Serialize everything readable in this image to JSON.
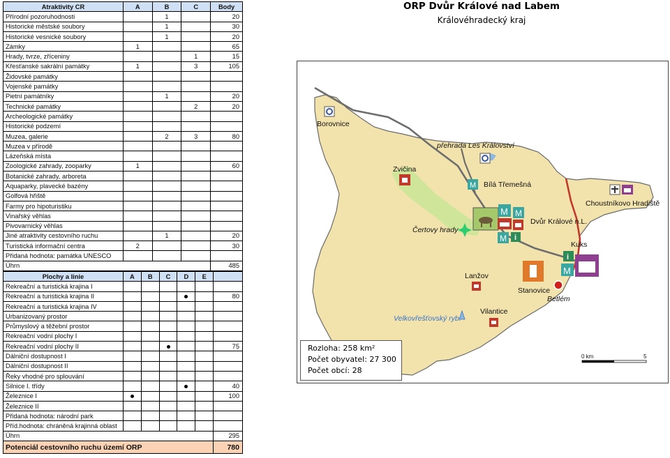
{
  "table_attractions": {
    "headers": [
      "Atraktivity CR",
      "A",
      "B",
      "C",
      "Body"
    ],
    "rows": [
      [
        "Přírodní pozoruhodnosti",
        "",
        "1",
        "",
        "20"
      ],
      [
        "Historické městské soubory",
        "",
        "1",
        "",
        "30"
      ],
      [
        "Historické vesnické soubory",
        "",
        "1",
        "",
        "20"
      ],
      [
        "Zámky",
        "1",
        "",
        "",
        "65"
      ],
      [
        "Hrady, tvrze, zříceniny",
        "",
        "",
        "1",
        "15"
      ],
      [
        "Křesťanské sakrální památky",
        "1",
        "",
        "3",
        "105"
      ],
      [
        "Židovské památky",
        "",
        "",
        "",
        ""
      ],
      [
        "Vojenské památky",
        "",
        "",
        "",
        ""
      ],
      [
        "Pietní památníky",
        "",
        "1",
        "",
        "20"
      ],
      [
        "Technické památky",
        "",
        "",
        "2",
        "20"
      ],
      [
        "Archeologické památky",
        "",
        "",
        "",
        ""
      ],
      [
        "Historické podzemí",
        "",
        "",
        "",
        ""
      ],
      [
        "Muzea, galerie",
        "",
        "2",
        "3",
        "80"
      ],
      [
        "Muzea v přírodě",
        "",
        "",
        "",
        ""
      ],
      [
        "Lázeňská místa",
        "",
        "",
        "",
        ""
      ],
      [
        "Zoologické zahrady, zooparky",
        "1",
        "",
        "",
        "60"
      ],
      [
        "Botanické zahrady, arboreta",
        "",
        "",
        "",
        ""
      ],
      [
        "Aquaparky, plavecké bazény",
        "",
        "",
        "",
        ""
      ],
      [
        "Golfová hřiště",
        "",
        "",
        "",
        ""
      ],
      [
        "Farmy pro hipoturistiku",
        "",
        "",
        "",
        ""
      ],
      [
        "Vinařský věhlas",
        "",
        "",
        "",
        ""
      ],
      [
        "Pivovarnický věhlas",
        "",
        "",
        "",
        ""
      ],
      [
        "Jiné atraktivity cestovního ruchu",
        "",
        "1",
        "",
        "20"
      ],
      [
        "Turistická informační centra",
        "2",
        "",
        "",
        "30"
      ],
      [
        "Přidaná hodnota: památka UNESCO",
        "",
        "",
        "",
        ""
      ]
    ],
    "sum_label": "Úhrn",
    "sum_value": "485"
  },
  "table_areas": {
    "headers": [
      "Plochy a linie",
      "A",
      "B",
      "C",
      "D",
      "E",
      ""
    ],
    "rows": [
      {
        "label": "Rekreační a turistická krajina I",
        "dot": -1,
        "value": ""
      },
      {
        "label": "Rekreační a turistická krajina II",
        "dot": 3,
        "value": "80"
      },
      {
        "label": "Rekreační a turistická krajina IV",
        "dot": -1,
        "value": ""
      },
      {
        "label": "Urbanizovaný prostor",
        "dot": -1,
        "value": ""
      },
      {
        "label": "Průmyslový a těžební prostor",
        "dot": -1,
        "value": ""
      },
      {
        "label": "Rekreační vodní plochy I",
        "dot": -1,
        "value": ""
      },
      {
        "label": "Rekreační vodní plochy II",
        "dot": 2,
        "value": "75"
      },
      {
        "label": "Dálniční dostupnost I",
        "dot": -1,
        "value": ""
      },
      {
        "label": "Dálniční dostupnost II",
        "dot": -1,
        "value": ""
      },
      {
        "label": "Řeky vhodné pro splouvání",
        "dot": -1,
        "value": ""
      },
      {
        "label": "Silnice I. třídy",
        "dot": 3,
        "value": "40"
      },
      {
        "label": "Železnice I",
        "dot": 0,
        "value": "100"
      },
      {
        "label": "Železnice II",
        "dot": -1,
        "value": ""
      },
      {
        "label": "Přidaná hodnota: národní park",
        "dot": -1,
        "value": ""
      },
      {
        "label": "Příd.hodnota: chráněná krajinná oblast",
        "dot": -1,
        "value": ""
      }
    ],
    "sum_label": "Úhrn",
    "sum_value": "295",
    "total_label": "Potenciál cestovního ruchu území ORP",
    "total_value": "780"
  },
  "map": {
    "title": "ORP Dvůr Králové nad Labem",
    "subtitle": "Královéhradecký kraj",
    "places": {
      "borovnice": "Borovnice",
      "prehrada": "přehrada Les Království",
      "zvicina": "Zvičina",
      "bila": "Bílá Třemešná",
      "choustnikovo": "Choustníkovo Hradiště",
      "certovy": "Čertovy hrady",
      "dvur": "Dvůr Králové n.L.",
      "kuks": "Kuks",
      "lanzov": "Lanžov",
      "stanovice": "Stanovice",
      "betlem": "Betlém",
      "velkovresovsky": "Velkovřešťovský ryb.",
      "vilantice": "Vilantice"
    },
    "icon_letter_m": "M",
    "icon_letter_i": "i",
    "stats": {
      "area": "Rozloha: 258 km²",
      "population": "Počet obyvatel: 27 300",
      "municipalities": "Počet obcí: 28"
    },
    "scale": {
      "zero": "0 km",
      "five": "5"
    },
    "colors": {
      "region": "#f2e3ad",
      "green": "#cfe69a",
      "rail": "#6d6d6d",
      "road": "#c0392b",
      "border": "#555555"
    }
  }
}
